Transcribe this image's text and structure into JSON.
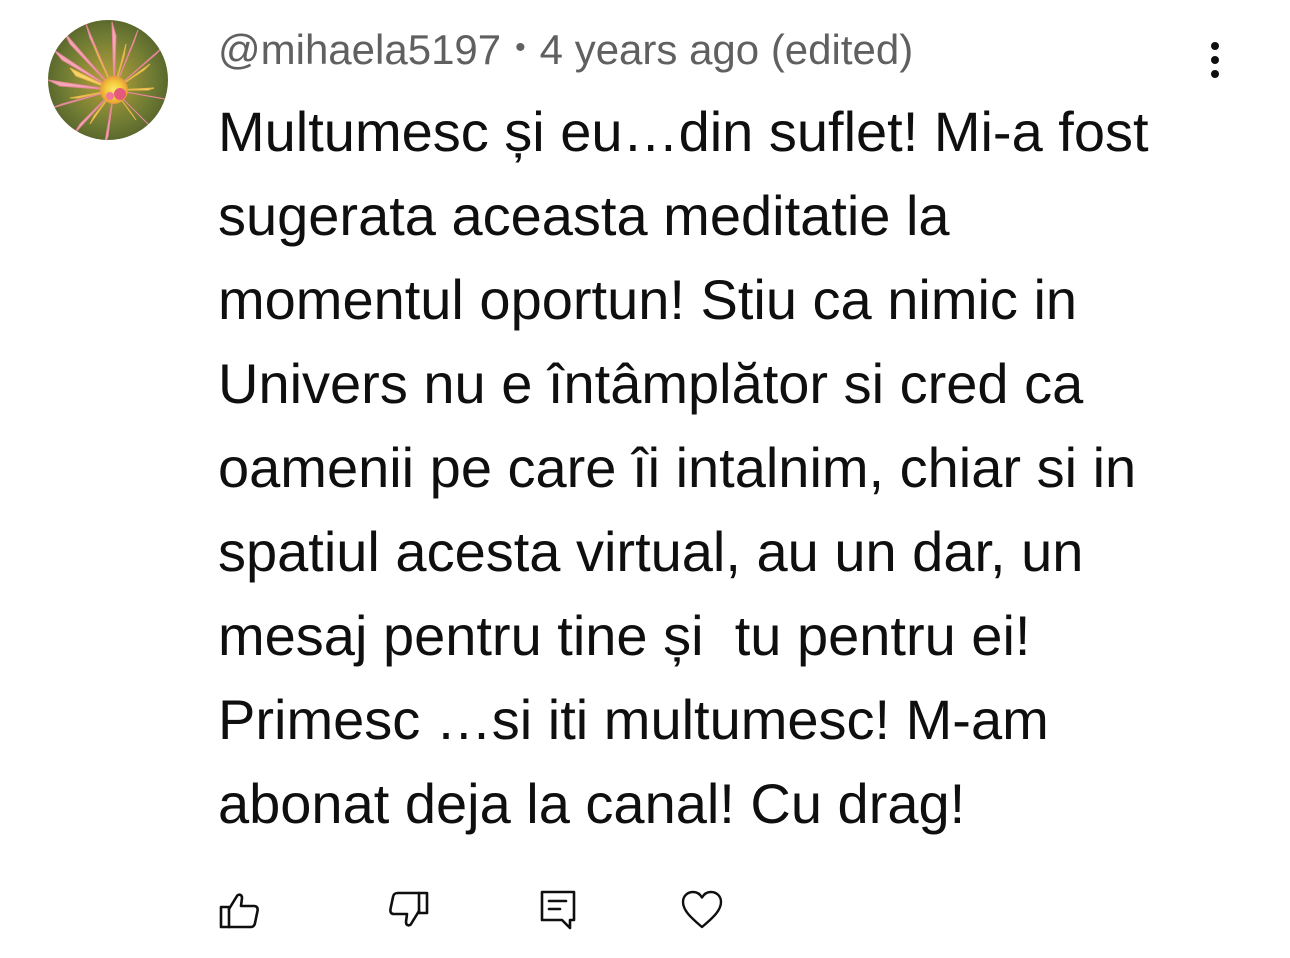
{
  "comment": {
    "author": "@mihaela5197",
    "separator": "•",
    "timestamp": "4 years ago (edited)",
    "text": "Multumesc și eu…din suflet! Mi-a fost\nsugerata aceasta meditatie la\nmomentul oportun! Stiu ca nimic in\nUnivers nu e întâmplător si cred ca\noamenii pe care îi intalnim, chiar si in\nspatiul acesta virtual, au un dar, un\nmesaj pentru tine și  tu pentru ei!\nPrimesc …si iti multumesc! M-am\nabonat deja la canal! Cu drag!",
    "avatar_icon": "flower-avatar"
  },
  "actions": [
    {
      "name": "like",
      "icon": "thumbs-up-icon"
    },
    {
      "name": "dislike",
      "icon": "thumbs-down-icon"
    },
    {
      "name": "reply",
      "icon": "comment-icon"
    },
    {
      "name": "heart",
      "icon": "heart-icon"
    }
  ],
  "menu_icon": "more-vertical-icon",
  "colors": {
    "text": "#0f0f0f",
    "meta": "#606060",
    "background": "#ffffff"
  }
}
